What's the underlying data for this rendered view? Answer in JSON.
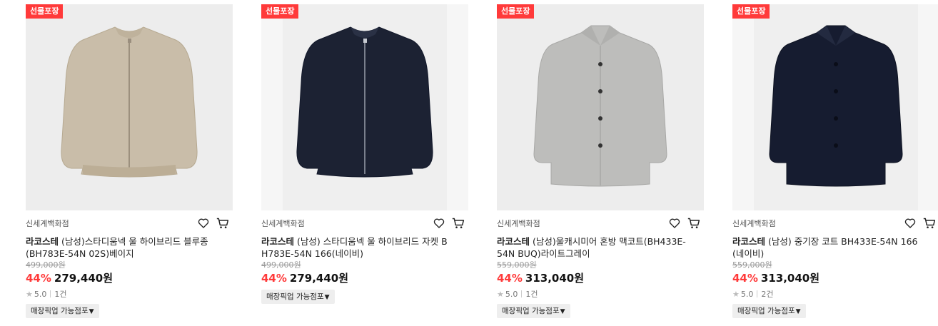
{
  "badge": "선물포장",
  "products": [
    {
      "store": "신세계백화점",
      "brand": "라코스테",
      "name": " (남성)스타디움넥 울 하이브리드 블루종(BH783E-54N 02S)베이지",
      "original_price": "499,000원",
      "discount": "44%",
      "price": "279,440원",
      "rating": "5.0",
      "reviews": "1건",
      "pickup": "매장픽업 가능점포",
      "color": "#c9bda9"
    },
    {
      "store": "신세계백화점",
      "brand": "라코스테",
      "name": " (남성) 스타디움넥 울 하이브리드 자켓 BH783E-54N 166(네이비)",
      "original_price": "499,000원",
      "discount": "44%",
      "price": "279,440원",
      "pickup": "매장픽업 가능점포",
      "color": "#1c2233"
    },
    {
      "store": "신세계백화점",
      "brand": "라코스테",
      "name": " (남성)울캐시미어 혼방 맥코트(BH433E-54N BUQ)라이트그레이",
      "original_price": "559,000원",
      "discount": "44%",
      "price": "313,040원",
      "rating": "5.0",
      "reviews": "1건",
      "pickup": "매장픽업 가능점포",
      "color": "#bdbdbb"
    },
    {
      "store": "신세계백화점",
      "brand": "라코스테",
      "name": " (남성) 중기장 코트 BH433E-54N 166(네이비)",
      "original_price": "559,000원",
      "discount": "44%",
      "price": "313,040원",
      "rating": "5.0",
      "reviews": "2건",
      "pickup": "매장픽업 가능점포",
      "color": "#161c30"
    }
  ],
  "pickup_arrow": "▼",
  "star": "★"
}
